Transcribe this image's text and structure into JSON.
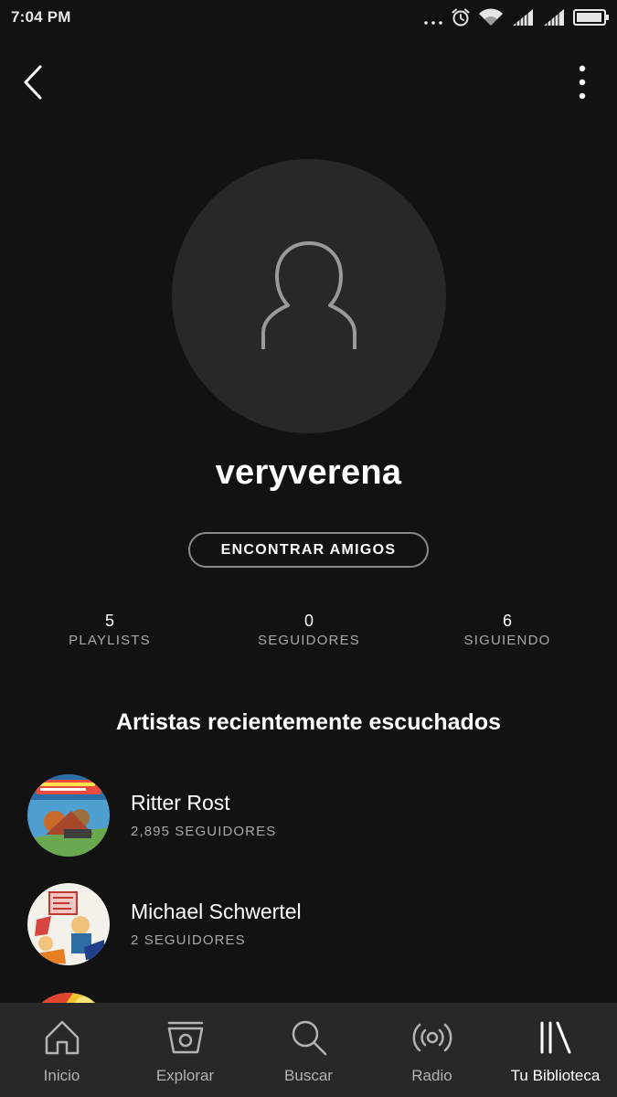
{
  "status_bar": {
    "time": "7:04 PM",
    "icons": [
      "more-notifications-icon",
      "alarm-icon",
      "wifi-icon",
      "signal-icon",
      "signal-icon",
      "battery-icon"
    ]
  },
  "profile": {
    "username": "veryverena",
    "find_friends_label": "ENCONTRAR AMIGOS",
    "stats": [
      {
        "value": "5",
        "label": "PLAYLISTS"
      },
      {
        "value": "0",
        "label": "SEGUIDORES"
      },
      {
        "value": "6",
        "label": "SIGUIENDO"
      }
    ]
  },
  "recent_artists": {
    "title": "Artistas recientemente escuchados",
    "items": [
      {
        "name": "Ritter Rost",
        "followers": "2,895 SEGUIDORES"
      },
      {
        "name": "Michael Schwertel",
        "followers": "2 SEGUIDORES"
      }
    ]
  },
  "bottom_nav": {
    "items": [
      {
        "label": "Inicio",
        "icon": "home-icon"
      },
      {
        "label": "Explorar",
        "icon": "browse-icon"
      },
      {
        "label": "Buscar",
        "icon": "search-icon"
      },
      {
        "label": "Radio",
        "icon": "radio-icon"
      },
      {
        "label": "Tu Biblioteca",
        "icon": "library-icon"
      }
    ],
    "active": "Tu Biblioteca"
  },
  "colors": {
    "background": "#121212",
    "nav_background": "#282828",
    "avatar_background": "#282828",
    "secondary_text": "#a8a8a8"
  }
}
